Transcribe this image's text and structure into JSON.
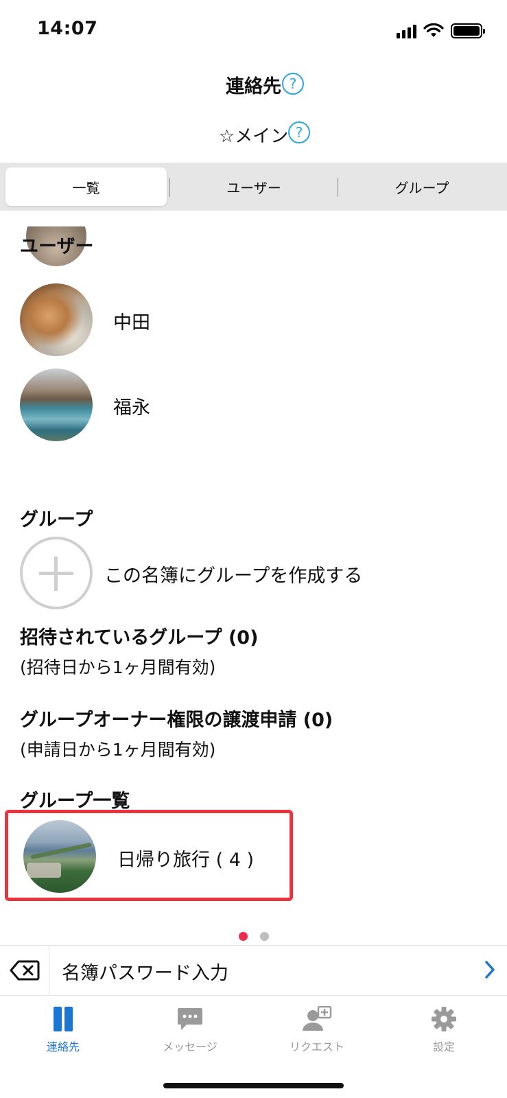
{
  "status_bar": {
    "time": "14:07"
  },
  "header": {
    "title": "連絡先",
    "subtitle": "☆メイン",
    "help_glyph": "?"
  },
  "tabs": [
    {
      "label": "一覧",
      "active": true
    },
    {
      "label": "ユーザー",
      "active": false
    },
    {
      "label": "グループ",
      "active": false
    }
  ],
  "users": {
    "heading": "ユーザー",
    "items": [
      {
        "name": "中田",
        "avatar": "cat-photo"
      },
      {
        "name": "福永",
        "avatar": "lake-photo"
      }
    ]
  },
  "groups": {
    "heading": "グループ",
    "create_label": "この名簿にグループを作成する",
    "invited_heading": "招待されているグループ (0)",
    "invited_note": "(招待日から1ヶ月間有効)",
    "transfer_heading": "グループオーナー権限の譲渡申請 (0)",
    "transfer_note": "(申請日から1ヶ月間有効)",
    "list_heading": "グループ一覧",
    "items": [
      {
        "name": "日帰り旅行 ( 4 )",
        "avatar": "coast-photo"
      }
    ]
  },
  "pager": {
    "total": 2,
    "current": 1
  },
  "password_bar": {
    "label": "名簿パスワード入力"
  },
  "tabbar": [
    {
      "label": "連絡先",
      "icon": "contacts-icon",
      "active": true
    },
    {
      "label": "メッセージ",
      "icon": "message-icon",
      "active": false
    },
    {
      "label": "リクエスト",
      "icon": "request-icon",
      "active": false
    },
    {
      "label": "設定",
      "icon": "gear-icon",
      "active": false
    }
  ],
  "colors": {
    "accent": "#1976d2",
    "help": "#2aa6e0",
    "highlight": "#e8343f",
    "pager_active": "#ec2b4e"
  }
}
